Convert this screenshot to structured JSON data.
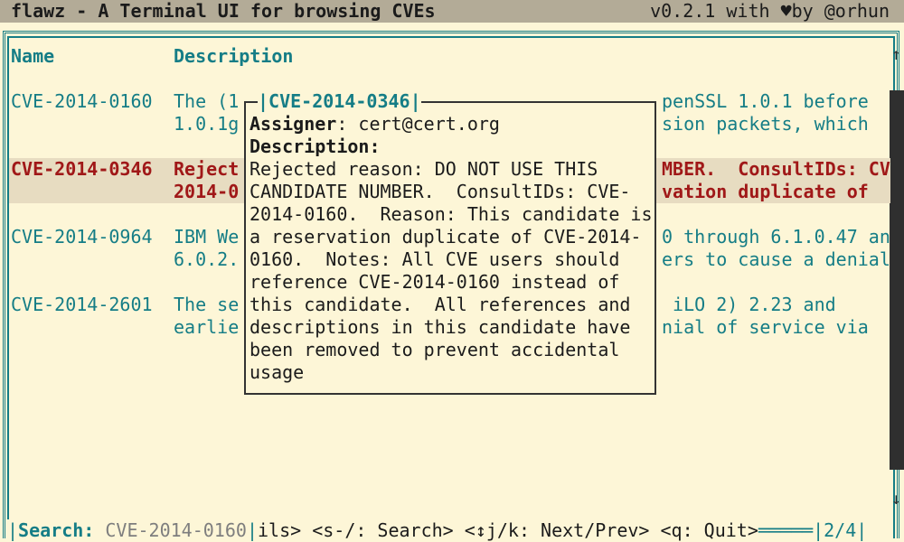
{
  "app": {
    "title": "flawz - A Terminal UI for browsing CVEs",
    "version": "v0.2.1 with ♥by @orhun"
  },
  "table": {
    "columns": [
      "Name",
      "Description"
    ],
    "rows": [
      {
        "name": "CVE-2014-0160",
        "desc_left_1": "The (1",
        "desc_left_2": "1.0.1g",
        "desc_right_1": "penSSL 1.0.1 before",
        "desc_right_2": "sion packets, which"
      },
      {
        "name": "CVE-2014-0346",
        "desc_left_1": "Reject",
        "desc_left_2": "2014-0",
        "desc_right_1": "MBER.  ConsultIDs: CV",
        "desc_right_2": "vation duplicate of"
      },
      {
        "name": "CVE-2014-0964",
        "desc_left_1": "IBM We",
        "desc_left_2": "6.0.2.",
        "desc_right_1": "0 through 6.1.0.47 an",
        "desc_right_2": "ers to cause a denial"
      },
      {
        "name": "CVE-2014-2601",
        "desc_left_1": "The se",
        "desc_left_2": "earlie",
        "desc_right_1": " iLO 2) 2.23 and",
        "desc_right_2": "nial of service via"
      }
    ]
  },
  "popup": {
    "title": "CVE-2014-0346",
    "assigner_label": "Assigner",
    "assigner_value": "cert@cert.org",
    "description_label": "Description",
    "lines": [
      "Rejected reason: DO NOT USE THIS",
      "CANDIDATE NUMBER.  ConsultIDs: CVE-",
      "2014-0160.  Reason: This candidate is",
      "a reservation duplicate of CVE-2014-",
      "0160.  Notes: All CVE users should",
      "reference CVE-2014-0160 instead of",
      "this candidate.  All references and",
      "descriptions in this candidate have",
      "been removed to prevent accidental",
      "usage"
    ]
  },
  "footer": {
    "search_label": "Search:",
    "search_value": "CVE-2014-0160",
    "hints": "ils> <s-/: Search> <↕j/k: Next/Prev> <q: Quit>",
    "page": "2/4"
  }
}
